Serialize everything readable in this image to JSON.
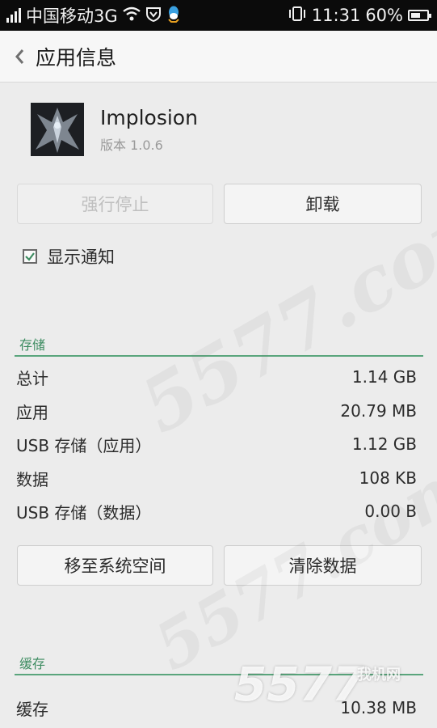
{
  "status_bar": {
    "carrier": "中国移动3G",
    "time": "11:31",
    "battery_percent": "60%",
    "battery_level": 0.6,
    "icons": [
      "signal-icon",
      "wifi-icon",
      "shield-icon",
      "qq-icon",
      "vibrate-icon",
      "battery-icon"
    ]
  },
  "header": {
    "title": "应用信息"
  },
  "app": {
    "name": "Implosion",
    "version": "版本 1.0.6"
  },
  "buttons": {
    "force_stop": "强行停止",
    "uninstall": "卸载"
  },
  "notification": {
    "label": "显示通知",
    "checked": true
  },
  "storage": {
    "title": "存储",
    "rows": [
      {
        "label": "总计",
        "value": "1.14 GB"
      },
      {
        "label": "应用",
        "value": "20.79 MB"
      },
      {
        "label": "USB 存储（应用）",
        "value": "1.12 GB"
      },
      {
        "label": "数据",
        "value": "108 KB"
      },
      {
        "label": "USB 存储（数据）",
        "value": "0.00 B"
      }
    ],
    "move_button": "移至系统空间",
    "clear_button": "清除数据"
  },
  "cache": {
    "title": "缓存",
    "rows": [
      {
        "label": "缓存",
        "value": "10.38 MB"
      }
    ]
  },
  "watermark": {
    "text": "5577.com",
    "logo": "5577",
    "logo_sub": "我机网"
  },
  "colors": {
    "accent": "#3d8c61",
    "status_bar": "#0b0b0b",
    "background": "#ececec"
  }
}
